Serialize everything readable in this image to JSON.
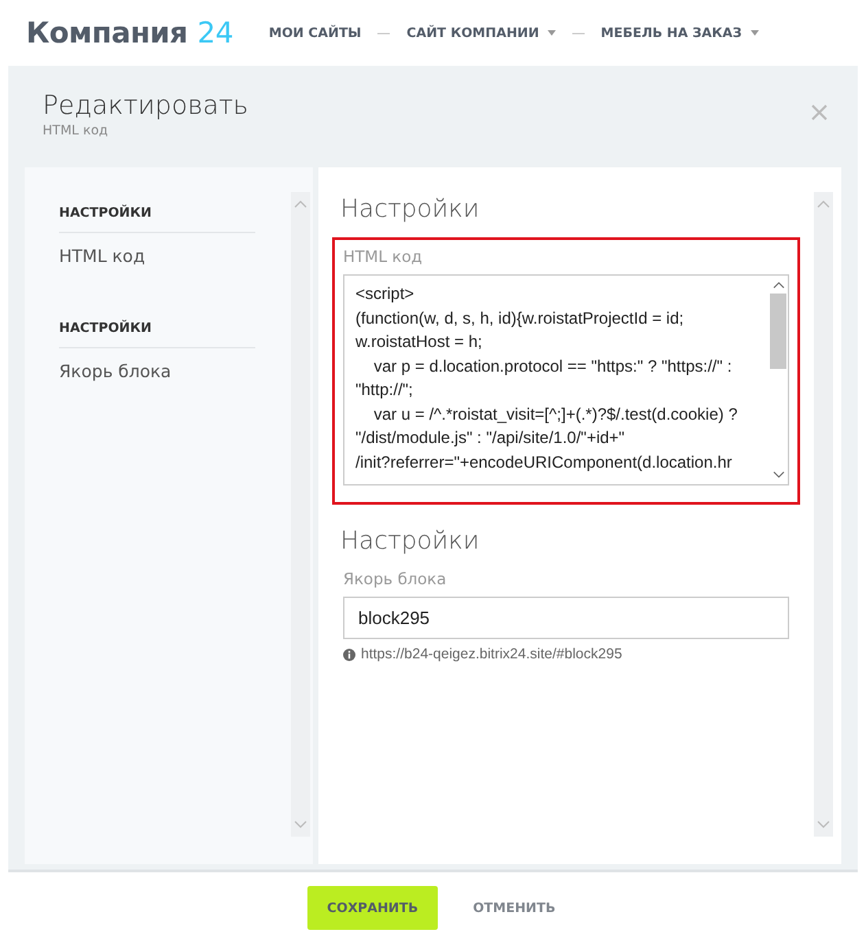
{
  "header": {
    "logo": {
      "name": "Компания",
      "suffix": "24"
    },
    "nav": [
      {
        "label": "МОИ САЙТЫ",
        "dropdown": false
      },
      {
        "label": "САЙТ КОМПАНИИ",
        "dropdown": true
      },
      {
        "label": "МЕБЕЛЬ НА ЗАКАЗ",
        "dropdown": true
      }
    ]
  },
  "dialog": {
    "title": "Редактировать",
    "subtitle": "HTML код",
    "sidebar": [
      {
        "heading": "НАСТРОЙКИ",
        "item": "HTML код"
      },
      {
        "heading": "НАСТРОЙКИ",
        "item": "Якорь блока"
      }
    ],
    "sections": [
      {
        "kind": "code",
        "title": "Настройки",
        "label": "HTML код",
        "highlighted": true,
        "lines": [
          "<script>",
          "(function(w, d, s, h, id){w.roistatProjectId = id;",
          "w.roistatHost = h;",
          "    var p = d.location.protocol == \"https:\" ? \"https://\" :",
          "\"http://\";",
          "    var u = /^.*roistat_visit=[^;]+(.*)?$/.test(d.cookie) ?",
          "\"/dist/module.js\" : \"/api/site/1.0/\"+id+\"",
          "/init?referrer=\"+encodeURIComponent(d.location.hr"
        ]
      },
      {
        "kind": "input",
        "title": "Настройки",
        "label": "Якорь блока",
        "value": "block295",
        "hint": "https://b24-qeigez.bitrix24.site/#block295"
      }
    ]
  },
  "footer": {
    "buttons": [
      {
        "label": "СОХРАНИТЬ",
        "kind": "primary"
      },
      {
        "label": "ОТМЕНИТЬ",
        "kind": "link"
      }
    ]
  }
}
